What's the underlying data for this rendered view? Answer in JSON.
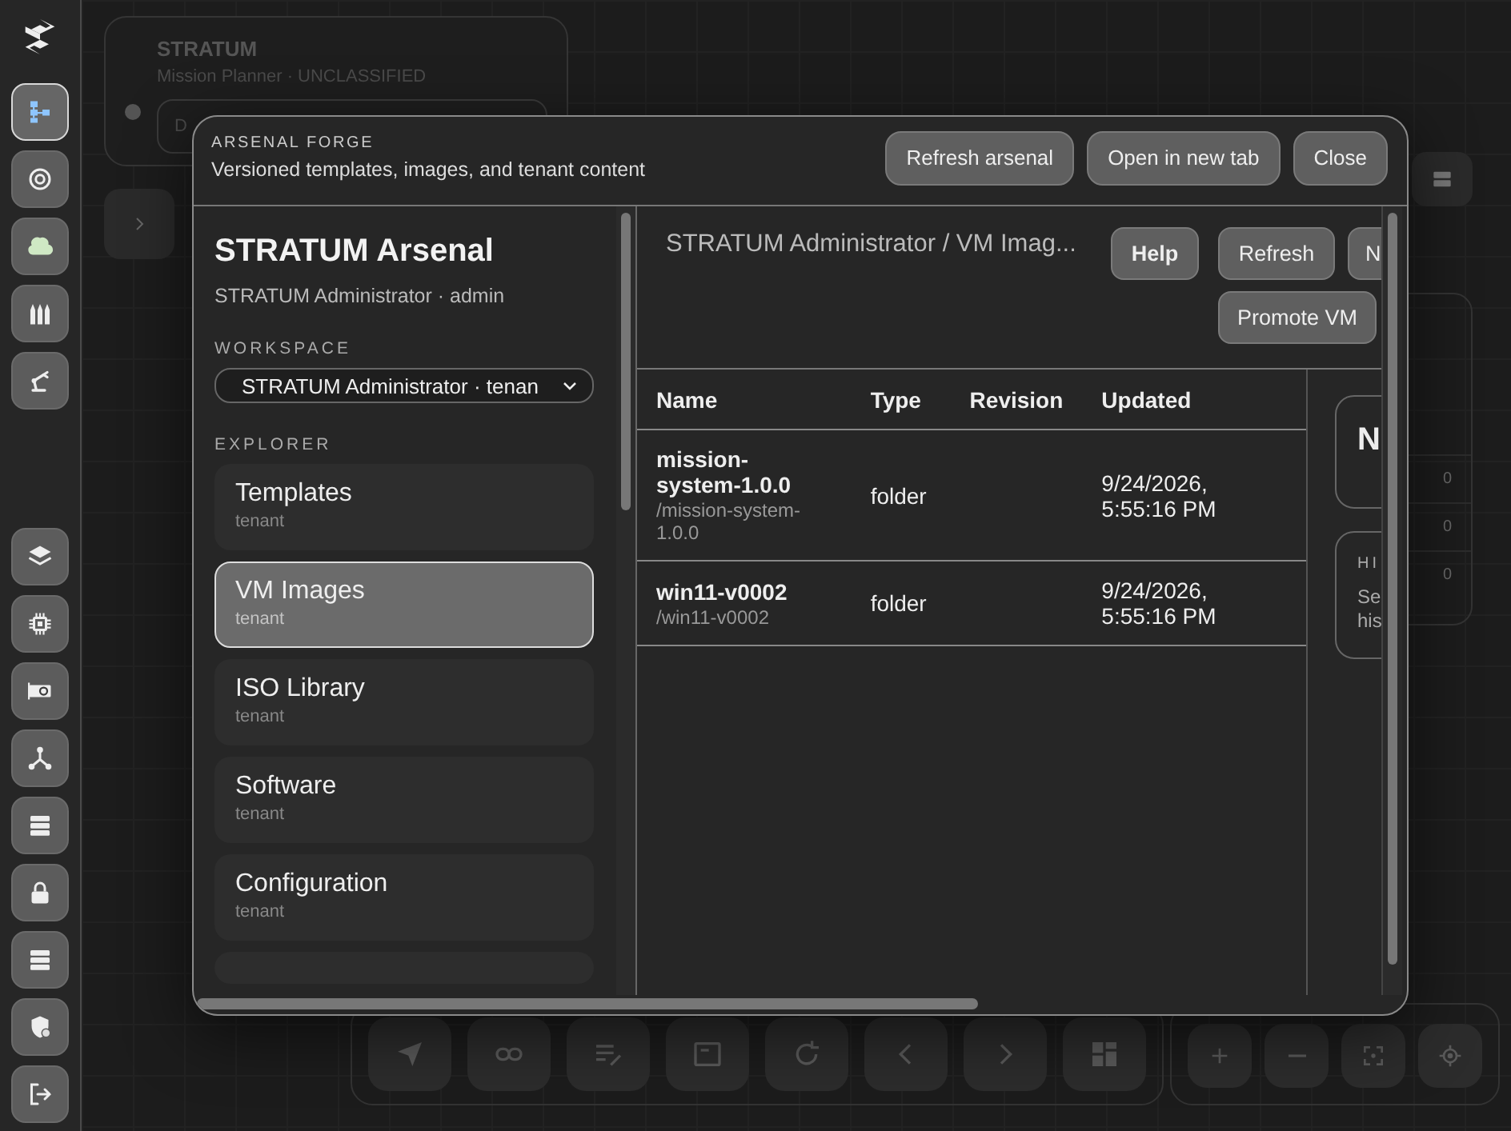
{
  "rail": {
    "top": [
      {
        "selected": true
      },
      {
        "selected": false
      },
      {
        "selected": false
      },
      {
        "selected": false
      },
      {
        "selected": false
      }
    ],
    "bottom": [
      {
        "selected": false
      },
      {
        "selected": false
      },
      {
        "selected": false
      },
      {
        "selected": false
      },
      {
        "selected": false
      },
      {
        "selected": false
      },
      {
        "selected": false
      },
      {
        "selected": false
      },
      {
        "selected": false
      }
    ]
  },
  "header": {
    "title": "STRATUM",
    "subtitle": "Mission Planner · UNCLASSIFIED",
    "field_text": "D"
  },
  "side_panel": {
    "values": [
      "0",
      "0",
      "0"
    ]
  },
  "modal": {
    "eyebrow": "ARSENAL FORGE",
    "subtitle": "Versioned templates, images, and tenant content",
    "actions": [
      "Refresh arsenal",
      "Open in new tab",
      "Close"
    ],
    "sidebar": {
      "title": "STRATUM Arsenal",
      "user": "STRATUM Administrator · admin",
      "workspace_label": "WORKSPACE",
      "workspace": "STRATUM Administrator · tenan",
      "explorer_label": "EXPLORER",
      "items": [
        {
          "label": "Templates",
          "scope": "tenant",
          "selected": false
        },
        {
          "label": "VM Images",
          "scope": "tenant",
          "selected": true
        },
        {
          "label": "ISO Library",
          "scope": "tenant",
          "selected": false
        },
        {
          "label": "Software",
          "scope": "tenant",
          "selected": false
        },
        {
          "label": "Configuration",
          "scope": "tenant",
          "selected": false
        }
      ]
    },
    "content": {
      "breadcrumb": "STRATUM Administrator / VM Imag...",
      "buttons": [
        {
          "label": "Help",
          "kind": "help"
        },
        {
          "label": "Refresh",
          "kind": "action"
        },
        {
          "label": "N",
          "kind": "action"
        },
        {
          "label": "Promote VM",
          "kind": "action"
        }
      ],
      "table": {
        "columns": [
          "Name",
          "Type",
          "Revision",
          "Updated"
        ],
        "rows": [
          {
            "name": "mission-system-1.0.0",
            "path": "/mission-system-1.0.0",
            "type": "folder",
            "updated": "9/24/2026, 5:55:16 PM"
          },
          {
            "name": "win11-v0002",
            "path": "/win11-v0002",
            "type": "folder",
            "updated": "9/24/2026, 5:55:16 PM"
          }
        ]
      },
      "cards": [
        {
          "title": "N"
        },
        {
          "label": "HI",
          "lines": [
            "Se",
            "his"
          ]
        }
      ]
    }
  }
}
